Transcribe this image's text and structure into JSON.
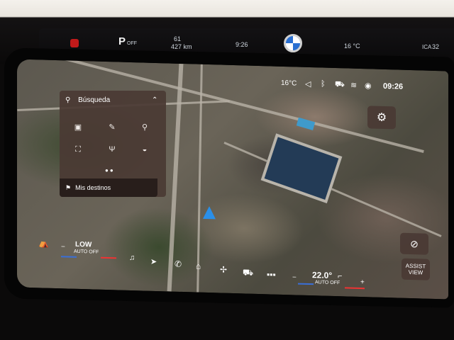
{
  "cluster": {
    "gear": "P",
    "gear_sub": "OFF",
    "range_value": "61",
    "range_sub": "427 km",
    "left_info": "bar",
    "time_small": "9:26",
    "outside_temp": "16 °C",
    "right_value": "32",
    "right_label": "ICA"
  },
  "status_bar": {
    "temperature": "16°C",
    "time": "09:26"
  },
  "search_panel": {
    "title": "Búsqueda",
    "destinations_label": "Mis destinos",
    "categories": [
      {
        "icon": "briefcase-icon",
        "glyph": "▣"
      },
      {
        "icon": "wrench-icon",
        "glyph": "✎"
      },
      {
        "icon": "charging-icon",
        "glyph": "⚲"
      },
      {
        "icon": "picnic-icon",
        "glyph": "⛶"
      },
      {
        "icon": "restaurant-icon",
        "glyph": "🍴"
      },
      {
        "icon": "burger-icon",
        "glyph": "◒"
      }
    ]
  },
  "right_panel": {
    "assist_view_label": "ASSIST\nVIEW"
  },
  "climate": {
    "left_fan": "LOW",
    "left_mode": "AUTO OFF",
    "right_temp": "22.0°",
    "right_mode": "AUTO OFF",
    "plus": "+",
    "minus": "−"
  },
  "colors": {
    "panel_bg": "#4a3a34",
    "accent_blue": "#2a8fe8",
    "accent_red": "#e33333"
  }
}
